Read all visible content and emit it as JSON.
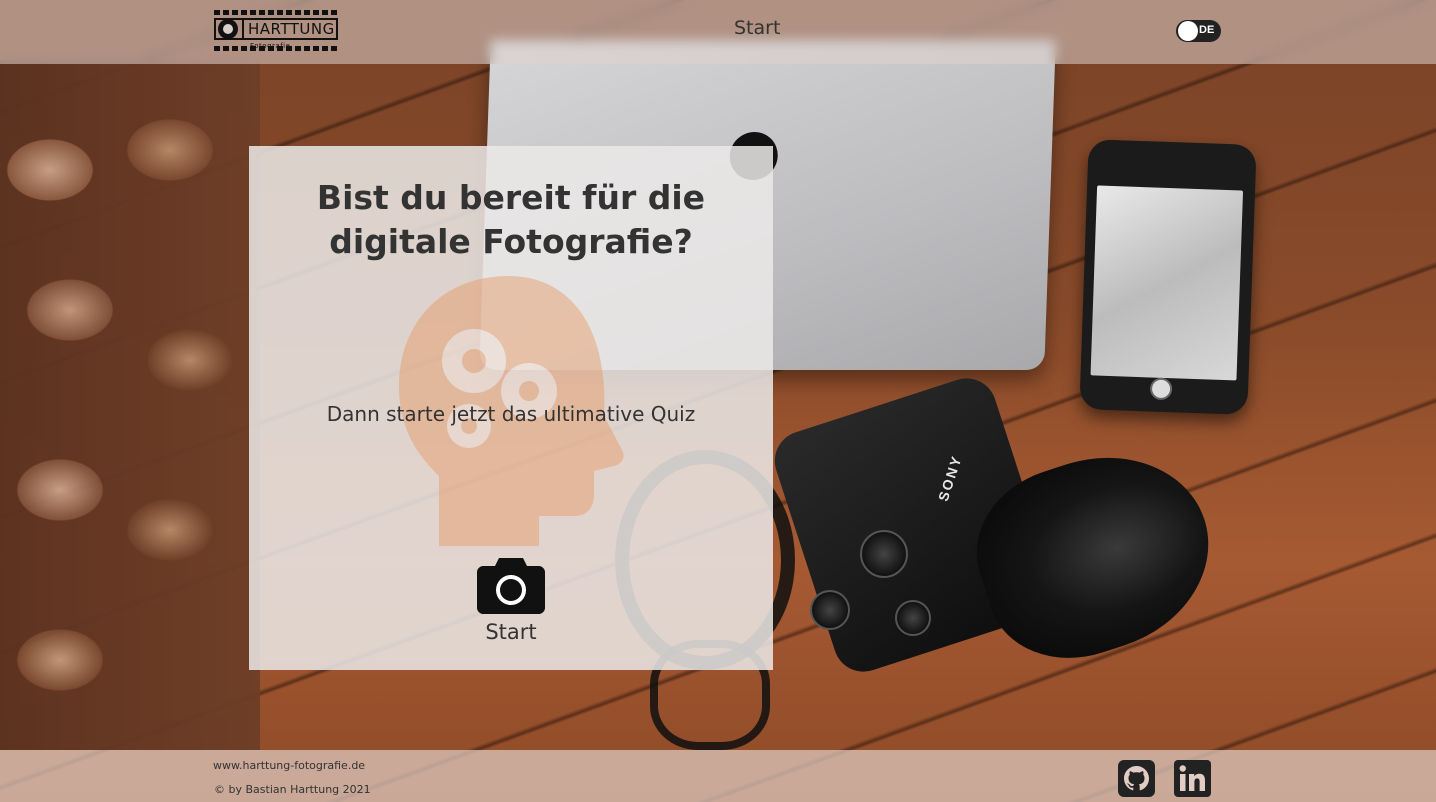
{
  "header": {
    "logo_text": "HARTTUNG",
    "logo_subtext": "Fotografie",
    "nav_start": "Start",
    "language_toggle": {
      "label": "DE"
    }
  },
  "card": {
    "title_line1": "Bist du bereit für die",
    "title_line2": "digitale Fotografie?",
    "subtitle": "Dann starte jetzt das ultimative Quiz",
    "start_label": "Start"
  },
  "background": {
    "camera_brand": "SONY"
  },
  "footer": {
    "url": "www.harttung-fotografie.de",
    "copyright": "© by Bastian Harttung 2021",
    "social": [
      "github-icon",
      "linkedin-icon"
    ]
  },
  "colors": {
    "card_bg": "#ebe9e8",
    "text": "#333333",
    "brain_accent": "#e8935a",
    "toggle_bg": "#222222"
  }
}
